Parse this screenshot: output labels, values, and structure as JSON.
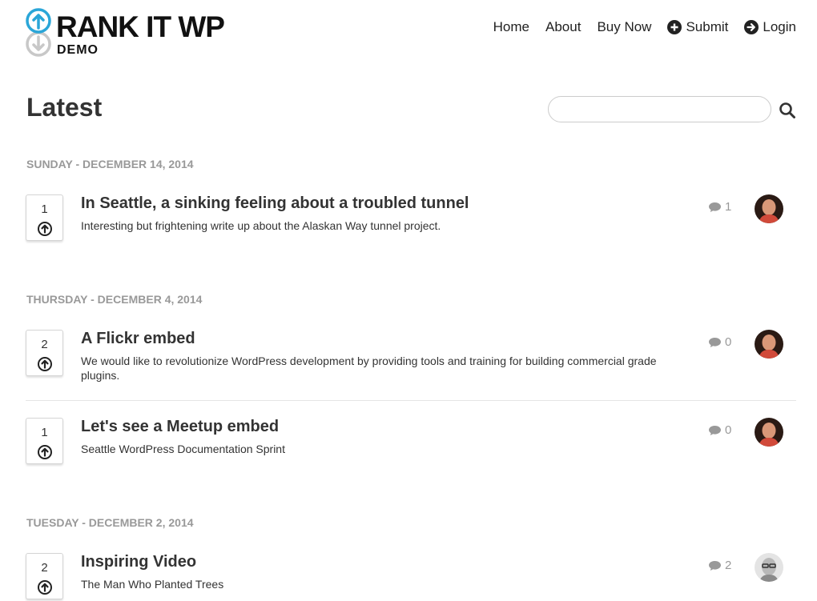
{
  "header": {
    "logo_title": "RANK IT WP",
    "logo_sub": "DEMO",
    "nav": [
      {
        "label": "Home"
      },
      {
        "label": "About"
      },
      {
        "label": "Buy Now"
      },
      {
        "label": "Submit",
        "icon": "plus-circle-icon"
      },
      {
        "label": "Login",
        "icon": "arrow-right-circle-icon"
      }
    ]
  },
  "page": {
    "title": "Latest",
    "search": {
      "value": "",
      "placeholder": ""
    }
  },
  "groups": [
    {
      "date": "SUNDAY - DECEMBER 14, 2014",
      "items": [
        {
          "votes": "1",
          "title": "In Seattle, a sinking feeling about a troubled tunnel",
          "desc": "Interesting but frightening write up about the Alaskan Way tunnel project.",
          "comments": "1"
        }
      ]
    },
    {
      "date": "THURSDAY - DECEMBER 4, 2014",
      "items": [
        {
          "votes": "2",
          "title": "A Flickr embed",
          "desc": "We would like to revolutionize WordPress development by providing tools and training for building commercial grade plugins.",
          "comments": "0"
        },
        {
          "votes": "1",
          "title": "Let's see a Meetup embed",
          "desc": "Seattle WordPress Documentation Sprint",
          "comments": "0"
        }
      ]
    },
    {
      "date": "TUESDAY - DECEMBER 2, 2014",
      "items": [
        {
          "votes": "2",
          "title": "Inspiring Video",
          "desc": "The Man Who Planted Trees",
          "comments": "2"
        }
      ]
    }
  ],
  "colors": {
    "logo_blue": "#2aa6d8",
    "logo_gray": "#c8c8c8",
    "muted": "#999999",
    "text": "#333333"
  }
}
